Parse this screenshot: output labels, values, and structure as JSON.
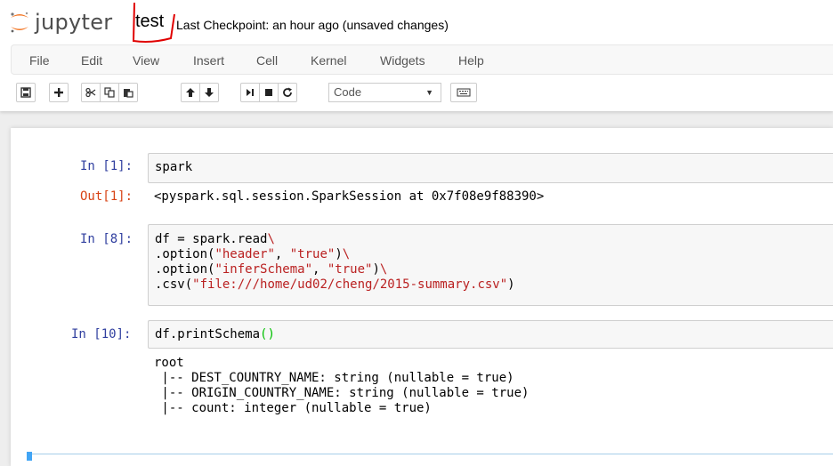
{
  "header": {
    "logo_text": "jupyter",
    "notebook_name": "test",
    "checkpoint": "Last Checkpoint: an hour ago (unsaved changes)"
  },
  "menu": [
    "File",
    "Edit",
    "View",
    "Insert",
    "Cell",
    "Kernel",
    "Widgets",
    "Help"
  ],
  "toolbar": {
    "cell_type": "Code",
    "icons": [
      "save-icon",
      "plus-icon",
      "scissors-icon",
      "copy-icon",
      "paste-icon",
      "arrow-up-icon",
      "arrow-down-icon",
      "run-icon",
      "stop-icon",
      "restart-icon",
      "keyboard-icon"
    ]
  },
  "cells": [
    {
      "in_prompt": "In [1]:",
      "code": [
        "spark"
      ],
      "out_prompt": "Out[1]:",
      "output": [
        "<pyspark.sql.session.SparkSession at 0x7f08e9f88390>"
      ]
    },
    {
      "in_prompt": "In [8]:",
      "code": [
        "df = spark.read",
        ".option(",
        "\"header\"",
        ", ",
        "\"true\"",
        ")",
        ".option(",
        "\"inferSchema\"",
        ", ",
        "\"true\"",
        ")",
        ".csv(",
        "\"file:///home/ud02/cheng/2015-summary.csv\"",
        ")",
        "\\"
      ]
    },
    {
      "in_prompt": "In [10]:",
      "code": [
        "df.printSchema",
        "()"
      ],
      "output": [
        "root",
        " |-- DEST_COUNTRY_NAME: string (nullable = true)",
        " |-- ORIGIN_COUNTRY_NAME: string (nullable = true)",
        " |-- count: integer (nullable = true)"
      ]
    }
  ],
  "colors": {
    "in_prompt": "#303f9f",
    "out_prompt": "#d84315",
    "string": "#ba2121",
    "annotation": "#e00000"
  }
}
